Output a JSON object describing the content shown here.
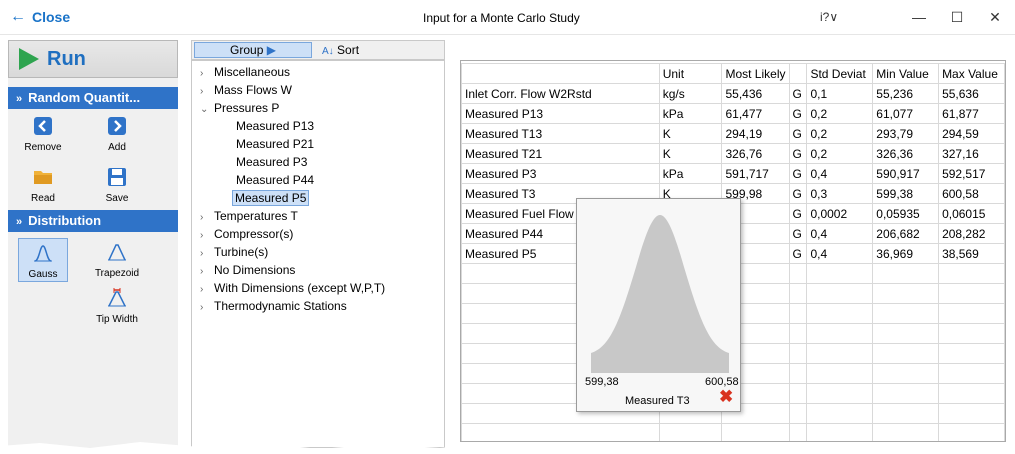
{
  "titlebar": {
    "close_label": "Close",
    "title": "Input for a Monte Carlo Study",
    "help": "i?∨",
    "minimize": "—",
    "maximize": "☐",
    "close": "✕"
  },
  "left": {
    "run_label": "Run",
    "random_section": "Random Quantit...",
    "tools": {
      "remove": "Remove",
      "add": "Add",
      "read": "Read",
      "save": "Save"
    },
    "distribution_section": "Distribution",
    "dist": {
      "gauss": "Gauss",
      "trapezoid": "Trapezoid",
      "tipwidth": "Tip Width"
    }
  },
  "tree": {
    "group_label": "Group",
    "sort_label": "Sort",
    "nodes": [
      "Miscellaneous",
      "Mass Flows W",
      "Pressures P",
      "Measured P13",
      "Measured P21",
      "Measured P3",
      "Measured P44",
      "Measured P5",
      "Temperatures T",
      "Compressor(s)",
      "Turbine(s)",
      "No Dimensions",
      "With Dimensions (except W,P,T)",
      "Thermodynamic Stations"
    ]
  },
  "grid": {
    "headers": [
      "",
      "Unit",
      "Most Likely",
      "",
      "Std Deviat",
      "Min Value",
      "Max Value"
    ],
    "rows": [
      [
        "Inlet Corr. Flow W2Rstd",
        "kg/s",
        "55,436",
        "G",
        "0,1",
        "55,236",
        "55,636"
      ],
      [
        "Measured P13",
        "kPa",
        "61,477",
        "G",
        "0,2",
        "61,077",
        "61,877"
      ],
      [
        "Measured T13",
        "K",
        "294,19",
        "G",
        "0,2",
        "293,79",
        "294,59"
      ],
      [
        "Measured T21",
        "K",
        "326,76",
        "G",
        "0,2",
        "326,36",
        "327,16"
      ],
      [
        "Measured P3",
        "kPa",
        "591,717",
        "G",
        "0,4",
        "590,917",
        "592,517"
      ],
      [
        "Measured T3",
        "K",
        "599,98",
        "G",
        "0,3",
        "599,38",
        "600,58"
      ],
      [
        "Measured Fuel Flow",
        "",
        "5",
        "G",
        "0,0002",
        "0,05935",
        "0,06015"
      ],
      [
        "Measured P44",
        "",
        "2",
        "G",
        "0,4",
        "206,682",
        "208,282"
      ],
      [
        "Measured P5",
        "",
        "",
        "G",
        "0,4",
        "36,969",
        "38,569"
      ]
    ]
  },
  "popup": {
    "low": "599,38",
    "high": "600,58",
    "name": "Measured T3"
  }
}
